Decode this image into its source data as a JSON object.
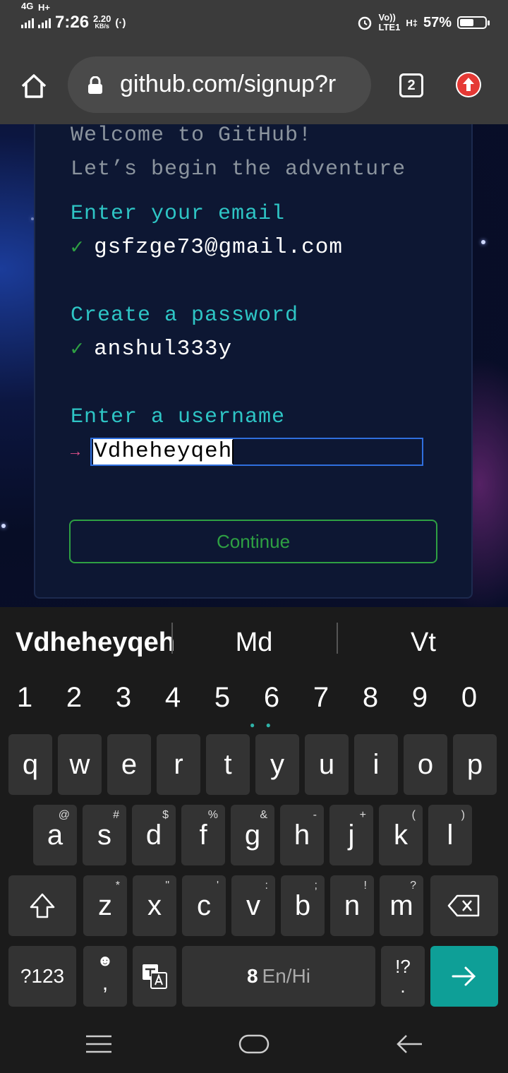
{
  "status_bar": {
    "network_1": "4G",
    "network_2": "H+",
    "time": "7:26",
    "speed_value": "2.20",
    "speed_unit": "KB/s",
    "volte": "Vo))",
    "lte": "LTE1",
    "network_3": "H‡",
    "battery": "57%",
    "battery_level": 0.57
  },
  "browser": {
    "url": "github.com/signup?r",
    "tab_count": "2"
  },
  "page": {
    "welcome_line1": "Welcome to GitHub!",
    "welcome_line2": "Let’s begin the adventure",
    "email_label": "Enter your email",
    "email_value": "gsfzge73@gmail.com",
    "password_label": "Create a password",
    "password_value": "anshul333y",
    "username_label": "Enter a username",
    "username_value": "Vdheheyqeh",
    "continue_label": "Continue",
    "check_mark": "✓",
    "arrow_mark": "→",
    "accent_green": "#2ea043",
    "accent_cyan": "#2ec5c5"
  },
  "keyboard": {
    "suggestions": [
      "Vdheheyqeh",
      "Md",
      "Vt"
    ],
    "numbers": [
      "1",
      "2",
      "3",
      "4",
      "5",
      "6",
      "7",
      "8",
      "9",
      "0"
    ],
    "row1": [
      "q",
      "w",
      "e",
      "r",
      "t",
      "y",
      "u",
      "i",
      "o",
      "p"
    ],
    "row2": [
      [
        "a",
        "@"
      ],
      [
        "s",
        "#"
      ],
      [
        "d",
        "$"
      ],
      [
        "f",
        "%"
      ],
      [
        "g",
        "&"
      ],
      [
        "h",
        "-"
      ],
      [
        "j",
        "+"
      ],
      [
        "k",
        "("
      ],
      [
        "l",
        ")"
      ]
    ],
    "row3": [
      [
        "z",
        "*"
      ],
      [
        "x",
        "\""
      ],
      [
        "c",
        "'"
      ],
      [
        "v",
        ":"
      ],
      [
        "b",
        ";"
      ],
      [
        "n",
        "!"
      ],
      [
        "m",
        "?"
      ]
    ],
    "sym_key": "?123",
    "comma": ",",
    "space_label": "En/Hi",
    "punct": "!?",
    "punct_sub": "."
  }
}
